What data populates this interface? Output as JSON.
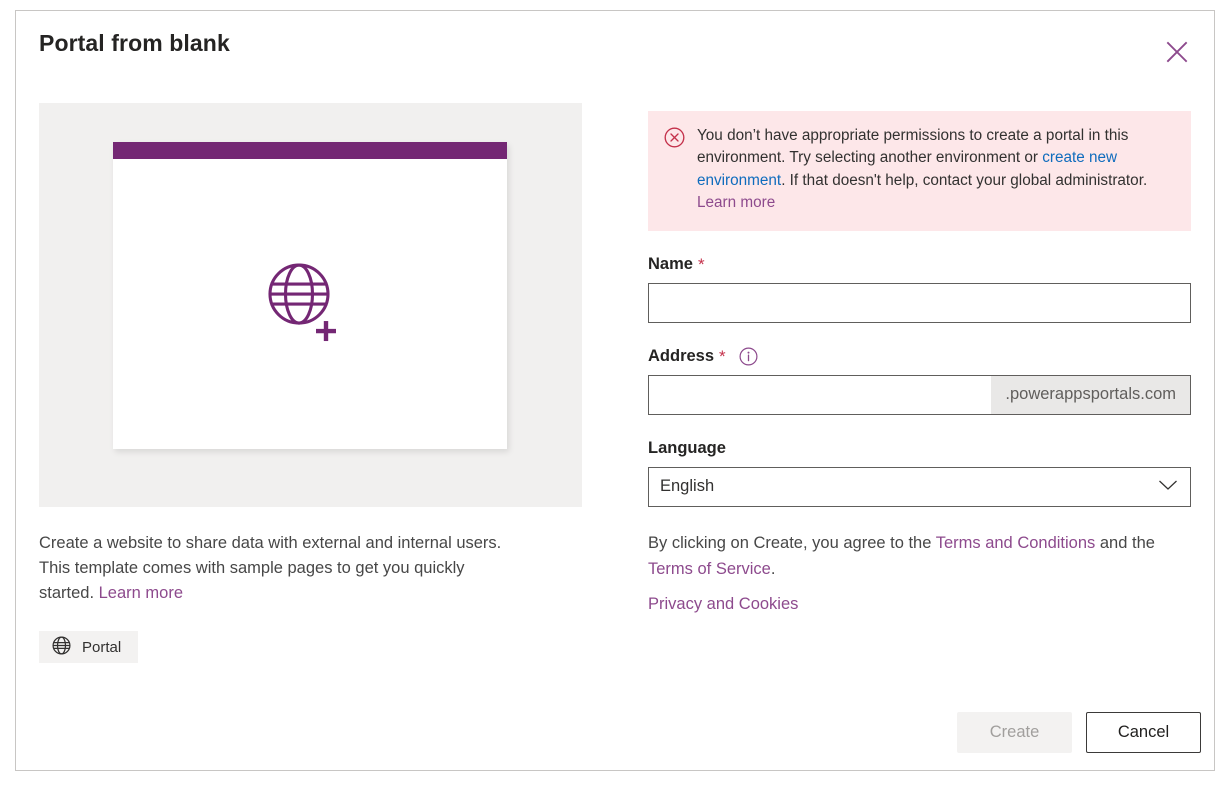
{
  "dialog": {
    "title": "Portal from blank",
    "close_icon": "close-icon"
  },
  "preview": {
    "icon": "globe-plus-icon",
    "header_bar_color": "#742774",
    "description_before_link": "Create a website to share data with external and internal users. This template comes with sample pages to get you quickly started. ",
    "description_link": "Learn more",
    "tag_icon": "globe-icon",
    "tag_label": "Portal"
  },
  "error": {
    "icon": "error-circle-x-icon",
    "line1": "You don’t have appropriate permissions to create a portal in this environment. Try selecting another environment or ",
    "link_environment": "create new environment",
    "line2": ". If that doesn't help, contact your global administrator. ",
    "link_learn_more": "Learn more",
    "background_color": "#fde7e9",
    "icon_color": "#c4314b",
    "link_color": "#0f6cbd"
  },
  "form": {
    "name_label": "Name",
    "name_required": "*",
    "name_value": "",
    "name_placeholder": "",
    "address_label": "Address",
    "address_required": "*",
    "address_info_icon": "info-icon",
    "address_value": "",
    "address_placeholder": "",
    "address_suffix": ".powerappsportals.com",
    "language_label": "Language",
    "language_value": "English",
    "language_options": [
      "English"
    ],
    "language_chevron_icon": "chevron-down-icon"
  },
  "legal": {
    "terms_prefix": "By clicking on Create, you agree to the ",
    "terms_and_conditions": "Terms and Conditions",
    "terms_middle": " and the ",
    "terms_of_service": "Terms of Service",
    "terms_suffix": ".",
    "privacy_and_cookies": "Privacy and Cookies",
    "link_color": "#8d4a8d"
  },
  "footer": {
    "create_label": "Create",
    "create_disabled": true,
    "cancel_label": "Cancel"
  },
  "theme": {
    "accent_purple": "#742774",
    "link_purple": "#8d4a8d",
    "text_dark": "#252423",
    "border_gray": "#605e5c"
  }
}
